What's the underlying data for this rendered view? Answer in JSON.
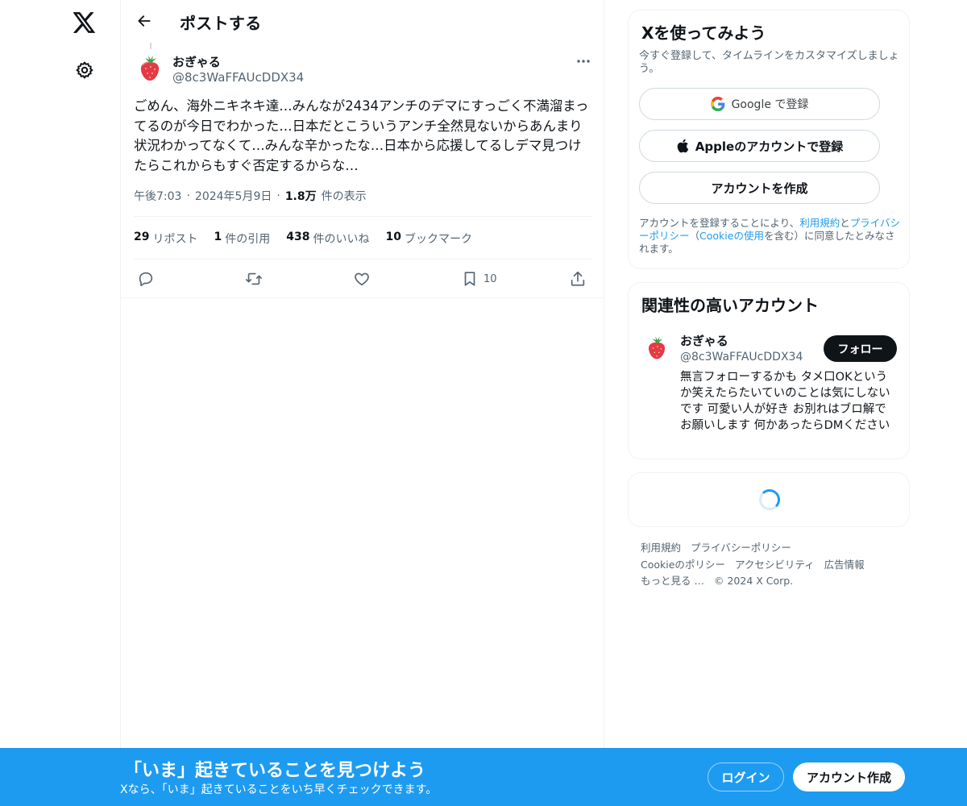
{
  "colors": {
    "accent": "#1d9bf0",
    "text": "#0f1419",
    "muted": "#536471",
    "border": "#eff3f4"
  },
  "nav": {
    "logo_icon": "x-logo-icon",
    "settings_icon": "gear-icon"
  },
  "header": {
    "title": "ポストする",
    "back_icon": "arrow-left-icon"
  },
  "post": {
    "author_name": "おぎゃる",
    "author_handle": "@8c3WaFFAUcDDX34",
    "text": "ごめん、海外ニキネキ達…みんなが2434アンチのデマにすっごく不満溜まってるのが今日でわかった…日本だとこういうアンチ全然見ないからあんまり状況わかってなくて…みんな辛かったな…日本から応援してるしデマ見つけたらこれからもすぐ否定するからな…",
    "time": "午後7:03",
    "date": "2024年5月9日",
    "separator": "·",
    "views_count": "1.8万",
    "views_label": "件の表示",
    "stats": {
      "reposts_count": "29",
      "reposts_label": "リポスト",
      "quotes_count": "1",
      "quotes_label": "件の引用",
      "likes_count": "438",
      "likes_label": "件のいいね",
      "bookmarks_count": "10",
      "bookmarks_label": "ブックマーク"
    },
    "actions": {
      "bookmark_count": "10"
    }
  },
  "signup_card": {
    "title": "Xを使ってみよう",
    "subtitle": "今すぐ登録して、タイムラインをカスタマイズしましょう。",
    "google_label": "Google で登録",
    "apple_label": "Appleのアカウントで登録",
    "create_label": "アカウントを作成",
    "terms_pre": "アカウントを登録することにより、",
    "terms_link": "利用規約",
    "terms_and": "と",
    "privacy_link": "プライバシーポリシー",
    "terms_paren_open": "（",
    "cookie_link": "Cookieの使用",
    "terms_post": "を含む）に同意したとみなされます。"
  },
  "related": {
    "title": "関連性の高いアカウント",
    "name": "おぎゃる",
    "handle": "@8c3WaFFAUcDDX34",
    "follow_label": "フォロー",
    "bio": "無言フォローするかも タメ口OKというか笑えたらたいていのことは気にしないです 可愛い人が好き お別れはブロ解でお願いします 何かあったらDMください"
  },
  "footer": {
    "terms": "利用規約",
    "privacy": "プライバシーポリシー",
    "cookie": "Cookieのポリシー",
    "accessibility": "アクセシビリティ",
    "ads": "広告情報",
    "more": "もっと見る …",
    "copyright": "© 2024 X Corp."
  },
  "bottom_bar": {
    "title": "「いま」起きていることを見つけよう",
    "subtitle": "Xなら、「いま」起きていることをいち早くチェックできます。",
    "login_label": "ログイン",
    "signup_label": "アカウント作成"
  }
}
